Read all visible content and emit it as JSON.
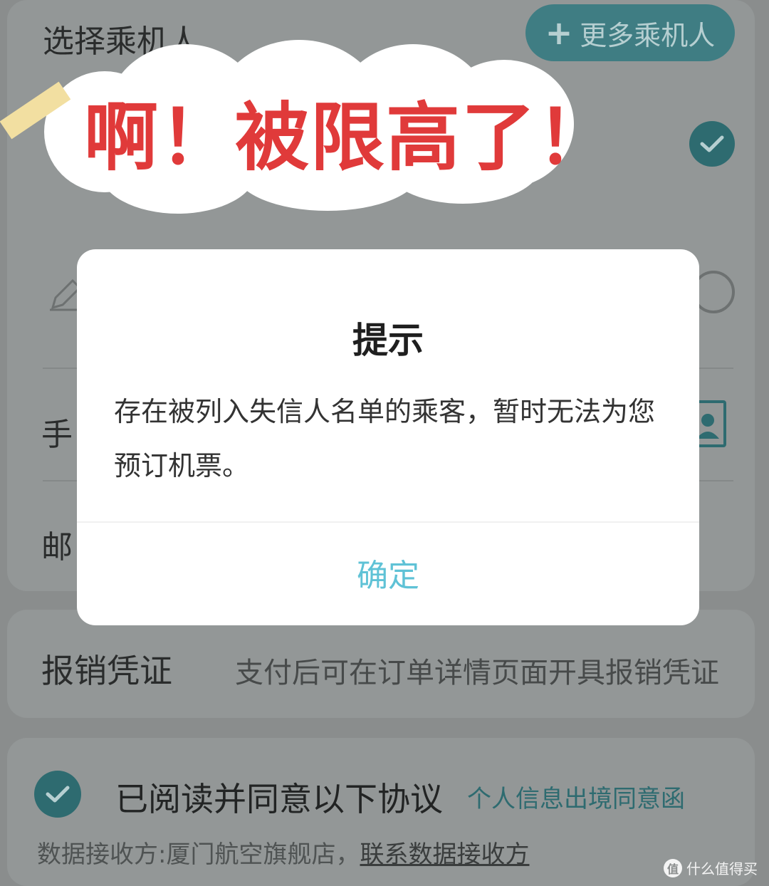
{
  "passenger_section": {
    "title": "选择乘机人",
    "more_button": "更多乘机人",
    "phone_label_partial": "手",
    "email_label_partial": "邮"
  },
  "overlay_caption": "啊！被限高了！",
  "dialog": {
    "title": "提示",
    "message": "存在被列入失信人名单的乘客，暂时无法为您预订机票。",
    "confirm": "确定"
  },
  "voucher": {
    "label": "报销凭证",
    "description": "支付后可在订单详情页面开具报销凭证"
  },
  "agreement": {
    "text": "已阅读并同意以下协议",
    "link": "个人信息出境同意函",
    "receiver_prefix": "数据接收方:厦门航空旗舰店，",
    "receiver_link": "联系数据接收方"
  },
  "watermark": {
    "text": "什么值得买",
    "icon": "值"
  },
  "colors": {
    "accent": "#2e6b70",
    "dialog_confirm": "#5fc2d6",
    "caption_red": "#e03a3a"
  }
}
